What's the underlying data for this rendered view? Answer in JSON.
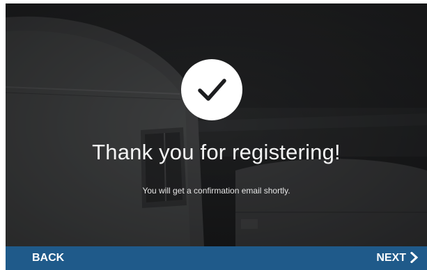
{
  "dialog": {
    "title": "Thank you for registering!",
    "message": "You will get a confirmation email shortly."
  },
  "icons": {
    "status": "checkmark-icon",
    "next": "chevron-right-icon"
  },
  "nav": {
    "back_label": "BACK",
    "next_label": "NEXT"
  },
  "colors": {
    "navbar": "#1f5a8a",
    "overlay": "#1c1d1f",
    "text": "#ffffff"
  }
}
